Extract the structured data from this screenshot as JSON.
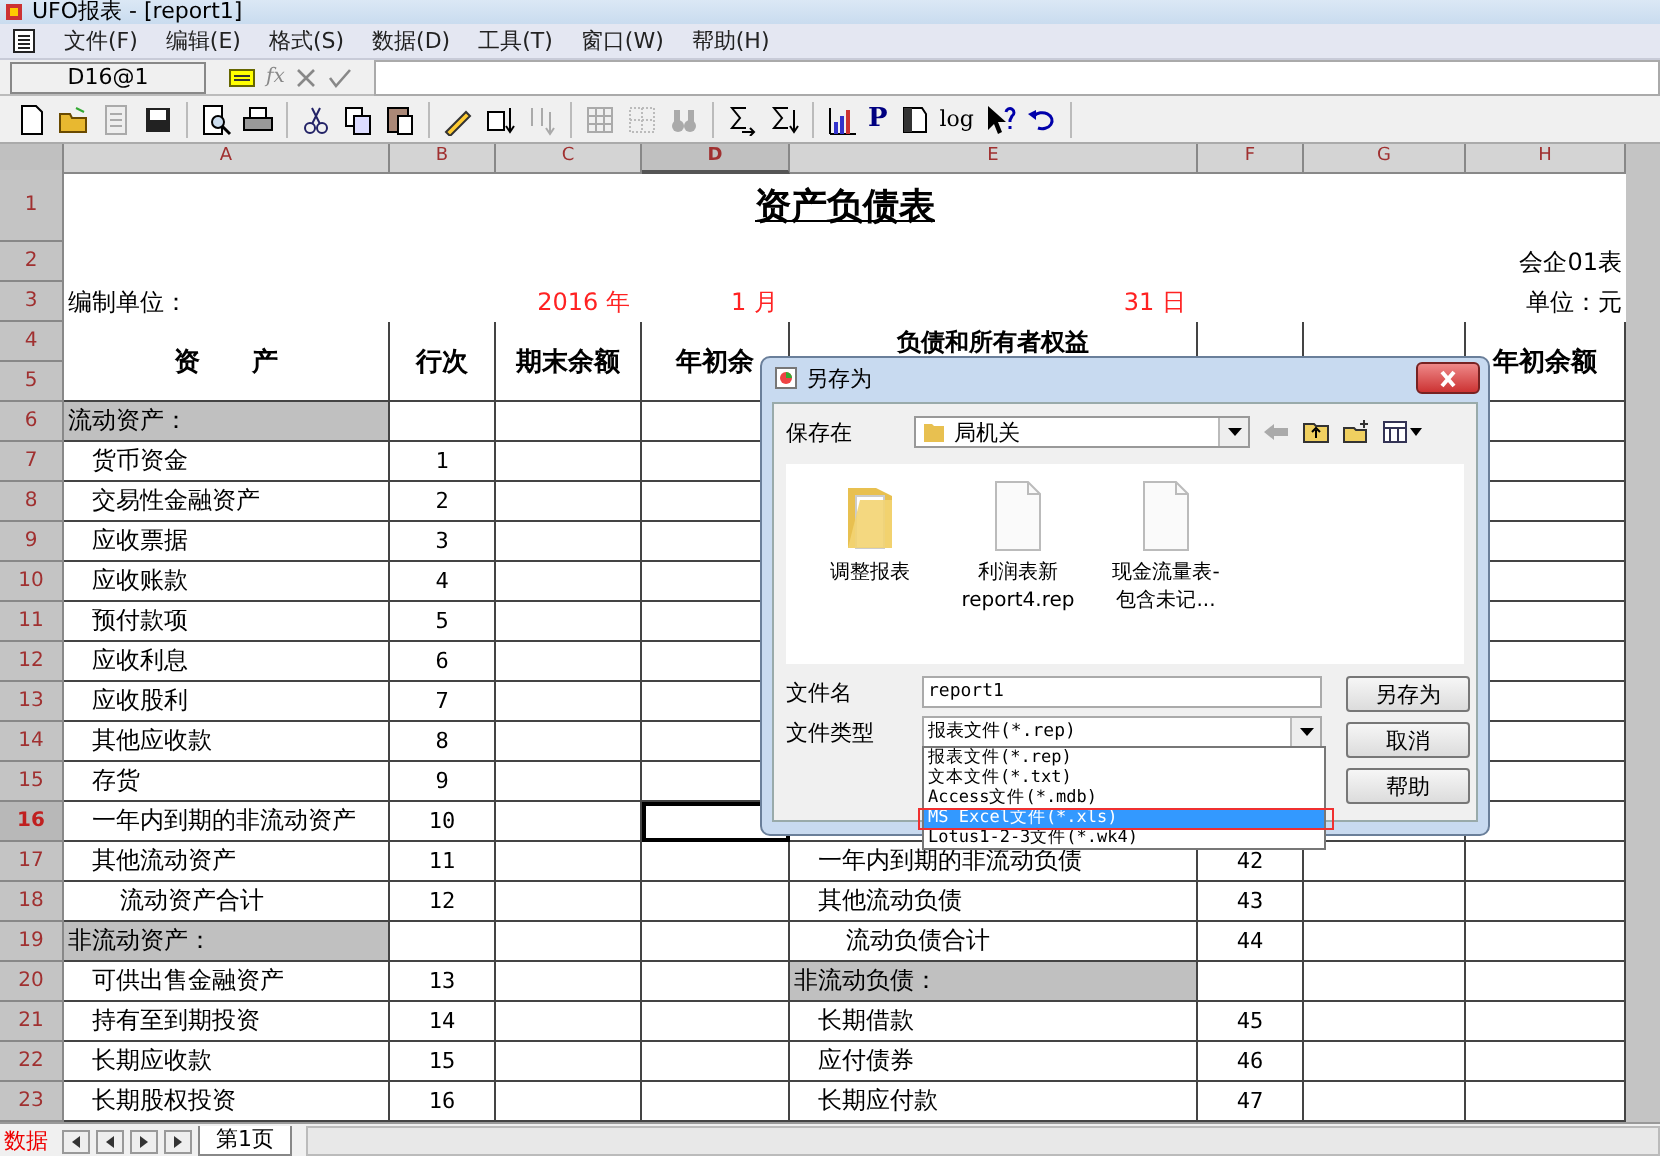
{
  "window": {
    "title": "UFO报表 - [report1]"
  },
  "menu": [
    {
      "label": "文件(F)"
    },
    {
      "label": "编辑(E)"
    },
    {
      "label": "格式(S)"
    },
    {
      "label": "数据(D)"
    },
    {
      "label": "工具(T)"
    },
    {
      "label": "窗口(W)"
    },
    {
      "label": "帮助(H)"
    }
  ],
  "formula_bar": {
    "cell_name": "D16@1",
    "fx_label": "fx"
  },
  "toolbar": {
    "text_buttons": [
      "P",
      "log"
    ]
  },
  "columns": [
    {
      "label": "A",
      "selected": false
    },
    {
      "label": "B",
      "selected": false
    },
    {
      "label": "C",
      "selected": false
    },
    {
      "label": "D",
      "selected": true
    },
    {
      "label": "E",
      "selected": false
    },
    {
      "label": "F",
      "selected": false
    },
    {
      "label": "G",
      "selected": false
    },
    {
      "label": "H",
      "selected": false
    }
  ],
  "rows": [
    {
      "kind": "title",
      "nums": [
        {
          "label": "1",
          "selected": false
        }
      ],
      "title": "资产负债表"
    },
    {
      "kind": "plain",
      "nums": [
        {
          "label": "2",
          "selected": false
        }
      ],
      "cells": {
        "h": {
          "text": "会企01表",
          "kind": "right"
        }
      }
    },
    {
      "kind": "plain",
      "nums": [
        {
          "label": "3",
          "selected": false
        }
      ],
      "cells": {
        "a": {
          "text": "编制单位：",
          "kind": "left"
        },
        "c": {
          "text": "2016  年",
          "kind": "date"
        },
        "d": {
          "text": "1  月",
          "kind": "date"
        },
        "e": {
          "text": "31  日",
          "kind": "date"
        },
        "h": {
          "text": "单位：元",
          "kind": "right"
        }
      }
    },
    {
      "kind": "header",
      "nums": [
        {
          "label": "4",
          "selected": false
        },
        {
          "label": "5",
          "selected": false
        }
      ],
      "cells": {
        "a": {
          "text": "资　　产",
          "kind": "head"
        },
        "b": {
          "text": "行次",
          "kind": "head"
        },
        "c": {
          "text": "期末余额",
          "kind": "head"
        },
        "d": {
          "text": "年初余",
          "kind": "head"
        },
        "e": {
          "text": "负债和所有者权益",
          "kind": "head-top"
        },
        "h": {
          "text": "年初余额",
          "kind": "head"
        }
      }
    },
    {
      "kind": "table",
      "nums": [
        {
          "label": "6",
          "selected": false
        }
      ],
      "cells": {
        "a": {
          "text": "流动资产：",
          "kind": "section"
        }
      }
    },
    {
      "kind": "table",
      "nums": [
        {
          "label": "7",
          "selected": false
        }
      ],
      "cells": {
        "a": {
          "text": "货币资金",
          "kind": "item"
        },
        "b": {
          "text": "1",
          "kind": "num"
        }
      }
    },
    {
      "kind": "table",
      "nums": [
        {
          "label": "8",
          "selected": false
        }
      ],
      "cells": {
        "a": {
          "text": "交易性金融资产",
          "kind": "item"
        },
        "b": {
          "text": "2",
          "kind": "num"
        }
      }
    },
    {
      "kind": "table",
      "nums": [
        {
          "label": "9",
          "selected": false
        }
      ],
      "cells": {
        "a": {
          "text": "应收票据",
          "kind": "item"
        },
        "b": {
          "text": "3",
          "kind": "num"
        }
      }
    },
    {
      "kind": "table",
      "nums": [
        {
          "label": "10",
          "selected": false
        }
      ],
      "cells": {
        "a": {
          "text": "应收账款",
          "kind": "item"
        },
        "b": {
          "text": "4",
          "kind": "num"
        }
      }
    },
    {
      "kind": "table",
      "nums": [
        {
          "label": "11",
          "selected": false
        }
      ],
      "cells": {
        "a": {
          "text": "预付款项",
          "kind": "item"
        },
        "b": {
          "text": "5",
          "kind": "num"
        }
      }
    },
    {
      "kind": "table",
      "nums": [
        {
          "label": "12",
          "selected": false
        }
      ],
      "cells": {
        "a": {
          "text": "应收利息",
          "kind": "item"
        },
        "b": {
          "text": "6",
          "kind": "num"
        }
      }
    },
    {
      "kind": "table",
      "nums": [
        {
          "label": "13",
          "selected": false
        }
      ],
      "cells": {
        "a": {
          "text": "应收股利",
          "kind": "item"
        },
        "b": {
          "text": "7",
          "kind": "num"
        }
      }
    },
    {
      "kind": "table",
      "nums": [
        {
          "label": "14",
          "selected": false
        }
      ],
      "cells": {
        "a": {
          "text": "其他应收款",
          "kind": "item"
        },
        "b": {
          "text": "8",
          "kind": "num"
        }
      }
    },
    {
      "kind": "table",
      "nums": [
        {
          "label": "15",
          "selected": false
        }
      ],
      "cells": {
        "a": {
          "text": "存货",
          "kind": "item"
        },
        "b": {
          "text": "9",
          "kind": "num"
        }
      }
    },
    {
      "kind": "table",
      "nums": [
        {
          "label": "16",
          "selected": true
        }
      ],
      "cells": {
        "a": {
          "text": "一年内到期的非流动资产",
          "kind": "item"
        },
        "b": {
          "text": "10",
          "kind": "num"
        }
      }
    },
    {
      "kind": "table",
      "nums": [
        {
          "label": "17",
          "selected": false
        }
      ],
      "cells": {
        "a": {
          "text": "其他流动资产",
          "kind": "item"
        },
        "b": {
          "text": "11",
          "kind": "num"
        },
        "e": {
          "text": "一年内到期的非流动负债",
          "kind": "item"
        },
        "f": {
          "text": "42",
          "kind": "num"
        }
      }
    },
    {
      "kind": "table",
      "nums": [
        {
          "label": "18",
          "selected": false
        }
      ],
      "cells": {
        "a": {
          "text": "流动资产合计",
          "kind": "total"
        },
        "b": {
          "text": "12",
          "kind": "num"
        },
        "e": {
          "text": "其他流动负债",
          "kind": "item"
        },
        "f": {
          "text": "43",
          "kind": "num"
        }
      }
    },
    {
      "kind": "table",
      "nums": [
        {
          "label": "19",
          "selected": false
        }
      ],
      "cells": {
        "a": {
          "text": "非流动资产：",
          "kind": "section"
        },
        "e": {
          "text": "流动负债合计",
          "kind": "total"
        },
        "f": {
          "text": "44",
          "kind": "num"
        }
      }
    },
    {
      "kind": "table",
      "nums": [
        {
          "label": "20",
          "selected": false
        }
      ],
      "cells": {
        "a": {
          "text": "可供出售金融资产",
          "kind": "item"
        },
        "b": {
          "text": "13",
          "kind": "num"
        },
        "e": {
          "text": "非流动负债：",
          "kind": "section"
        }
      }
    },
    {
      "kind": "table",
      "nums": [
        {
          "label": "21",
          "selected": false
        }
      ],
      "cells": {
        "a": {
          "text": "持有至到期投资",
          "kind": "item"
        },
        "b": {
          "text": "14",
          "kind": "num"
        },
        "e": {
          "text": "长期借款",
          "kind": "item"
        },
        "f": {
          "text": "45",
          "kind": "num"
        }
      }
    },
    {
      "kind": "table",
      "nums": [
        {
          "label": "22",
          "selected": false
        }
      ],
      "cells": {
        "a": {
          "text": "长期应收款",
          "kind": "item"
        },
        "b": {
          "text": "15",
          "kind": "num"
        },
        "e": {
          "text": "应付债券",
          "kind": "item"
        },
        "f": {
          "text": "46",
          "kind": "num"
        }
      }
    },
    {
      "kind": "table",
      "nums": [
        {
          "label": "23",
          "selected": false
        }
      ],
      "cells": {
        "a": {
          "text": "长期股权投资",
          "kind": "item"
        },
        "b": {
          "text": "16",
          "kind": "num"
        },
        "e": {
          "text": "长期应付款",
          "kind": "item"
        },
        "f": {
          "text": "47",
          "kind": "num"
        }
      }
    }
  ],
  "status_bar": {
    "mode": "数据",
    "sheet_tab": "第1页"
  },
  "dialog": {
    "title": "另存为",
    "save_in_label": "保存在",
    "save_in_value": "局机关",
    "files": [
      {
        "kind": "folder",
        "name": "调整报表"
      },
      {
        "kind": "file",
        "name": "利润表新\nreport4.rep"
      },
      {
        "kind": "file",
        "name": "现金流量表-\n包含未记..."
      }
    ],
    "filename_label": "文件名",
    "filename_value": "report1",
    "filetype_label": "文件类型",
    "filetype_value": "报表文件(*.rep)",
    "buttons": [
      "另存为",
      "取消",
      "帮助"
    ],
    "filetype_options": [
      {
        "label": "报表文件(*.rep)",
        "selected": false
      },
      {
        "label": "文本文件(*.txt)",
        "selected": false
      },
      {
        "label": "Access文件(*.mdb)",
        "selected": false
      },
      {
        "label": "MS Excel文件(*.xls)",
        "selected": true
      },
      {
        "label": "Lotus1-2-3文件(*.wk4)",
        "selected": false
      }
    ]
  }
}
